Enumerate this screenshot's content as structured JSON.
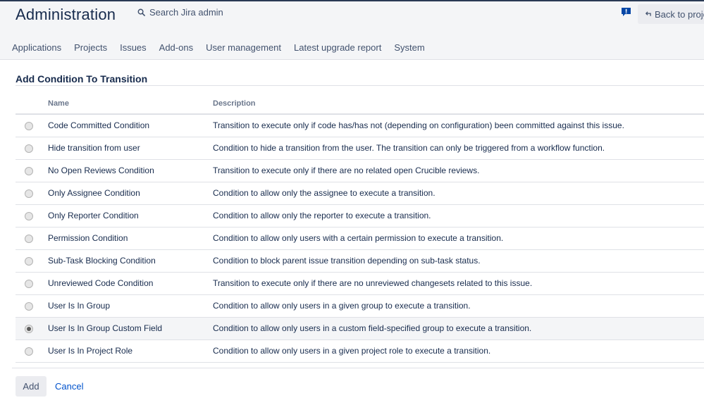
{
  "header": {
    "title": "Administration",
    "search_label": "Search Jira admin",
    "back_label": "Back to project"
  },
  "nav": [
    {
      "label": "Applications"
    },
    {
      "label": "Projects"
    },
    {
      "label": "Issues"
    },
    {
      "label": "Add-ons"
    },
    {
      "label": "User management"
    },
    {
      "label": "Latest upgrade report"
    },
    {
      "label": "System"
    }
  ],
  "section": {
    "title": "Add Condition To Transition"
  },
  "table": {
    "columns": {
      "name": "Name",
      "description": "Description"
    },
    "rows": [
      {
        "name": "Code Committed Condition",
        "description": "Transition to execute only if code has/has not (depending on configuration) been committed against this issue.",
        "selected": false
      },
      {
        "name": "Hide transition from user",
        "description": "Condition to hide a transition from the user. The transition can only be triggered from a workflow function.",
        "selected": false
      },
      {
        "name": "No Open Reviews Condition",
        "description": "Transition to execute only if there are no related open Crucible reviews.",
        "selected": false
      },
      {
        "name": "Only Assignee Condition",
        "description": "Condition to allow only the assignee to execute a transition.",
        "selected": false
      },
      {
        "name": "Only Reporter Condition",
        "description": "Condition to allow only the reporter to execute a transition.",
        "selected": false
      },
      {
        "name": "Permission Condition",
        "description": "Condition to allow only users with a certain permission to execute a transition.",
        "selected": false
      },
      {
        "name": "Sub-Task Blocking Condition",
        "description": "Condition to block parent issue transition depending on sub-task status.",
        "selected": false
      },
      {
        "name": "Unreviewed Code Condition",
        "description": "Transition to execute only if there are no unreviewed changesets related to this issue.",
        "selected": false
      },
      {
        "name": "User Is In Group",
        "description": "Condition to allow only users in a given group to execute a transition.",
        "selected": false
      },
      {
        "name": "User Is In Group Custom Field",
        "description": "Condition to allow only users in a custom field-specified group to execute a transition.",
        "selected": true
      },
      {
        "name": "User Is In Project Role",
        "description": "Condition to allow only users in a given project role to execute a transition.",
        "selected": false
      }
    ]
  },
  "actions": {
    "add_label": "Add",
    "cancel_label": "Cancel"
  },
  "colors": {
    "accent": "#0052cc",
    "header_bg": "#f4f5f7",
    "feedback_icon": "#0747a6"
  },
  "icons": {
    "search": "search-icon",
    "feedback": "feedback-icon",
    "back": "back-arrow-icon"
  }
}
